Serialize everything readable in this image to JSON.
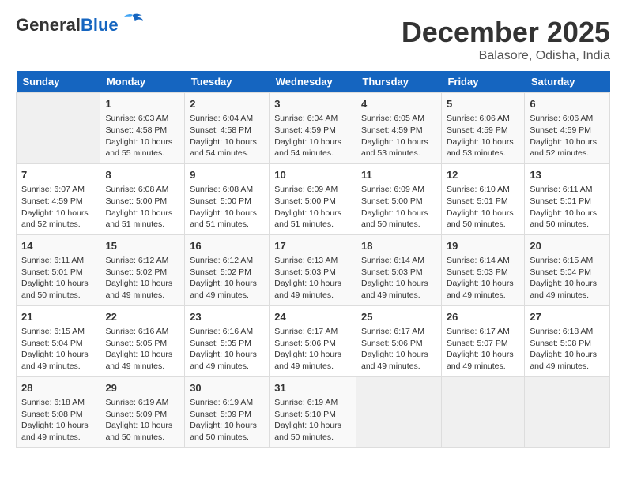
{
  "logo": {
    "line1": "General",
    "line2": "Blue"
  },
  "title": "December 2025",
  "location": "Balasore, Odisha, India",
  "weekdays": [
    "Sunday",
    "Monday",
    "Tuesday",
    "Wednesday",
    "Thursday",
    "Friday",
    "Saturday"
  ],
  "weeks": [
    [
      {
        "day": "",
        "info": ""
      },
      {
        "day": "1",
        "info": "Sunrise: 6:03 AM\nSunset: 4:58 PM\nDaylight: 10 hours\nand 55 minutes."
      },
      {
        "day": "2",
        "info": "Sunrise: 6:04 AM\nSunset: 4:58 PM\nDaylight: 10 hours\nand 54 minutes."
      },
      {
        "day": "3",
        "info": "Sunrise: 6:04 AM\nSunset: 4:59 PM\nDaylight: 10 hours\nand 54 minutes."
      },
      {
        "day": "4",
        "info": "Sunrise: 6:05 AM\nSunset: 4:59 PM\nDaylight: 10 hours\nand 53 minutes."
      },
      {
        "day": "5",
        "info": "Sunrise: 6:06 AM\nSunset: 4:59 PM\nDaylight: 10 hours\nand 53 minutes."
      },
      {
        "day": "6",
        "info": "Sunrise: 6:06 AM\nSunset: 4:59 PM\nDaylight: 10 hours\nand 52 minutes."
      }
    ],
    [
      {
        "day": "7",
        "info": "Sunrise: 6:07 AM\nSunset: 4:59 PM\nDaylight: 10 hours\nand 52 minutes."
      },
      {
        "day": "8",
        "info": "Sunrise: 6:08 AM\nSunset: 5:00 PM\nDaylight: 10 hours\nand 51 minutes."
      },
      {
        "day": "9",
        "info": "Sunrise: 6:08 AM\nSunset: 5:00 PM\nDaylight: 10 hours\nand 51 minutes."
      },
      {
        "day": "10",
        "info": "Sunrise: 6:09 AM\nSunset: 5:00 PM\nDaylight: 10 hours\nand 51 minutes."
      },
      {
        "day": "11",
        "info": "Sunrise: 6:09 AM\nSunset: 5:00 PM\nDaylight: 10 hours\nand 50 minutes."
      },
      {
        "day": "12",
        "info": "Sunrise: 6:10 AM\nSunset: 5:01 PM\nDaylight: 10 hours\nand 50 minutes."
      },
      {
        "day": "13",
        "info": "Sunrise: 6:11 AM\nSunset: 5:01 PM\nDaylight: 10 hours\nand 50 minutes."
      }
    ],
    [
      {
        "day": "14",
        "info": "Sunrise: 6:11 AM\nSunset: 5:01 PM\nDaylight: 10 hours\nand 50 minutes."
      },
      {
        "day": "15",
        "info": "Sunrise: 6:12 AM\nSunset: 5:02 PM\nDaylight: 10 hours\nand 49 minutes."
      },
      {
        "day": "16",
        "info": "Sunrise: 6:12 AM\nSunset: 5:02 PM\nDaylight: 10 hours\nand 49 minutes."
      },
      {
        "day": "17",
        "info": "Sunrise: 6:13 AM\nSunset: 5:03 PM\nDaylight: 10 hours\nand 49 minutes."
      },
      {
        "day": "18",
        "info": "Sunrise: 6:14 AM\nSunset: 5:03 PM\nDaylight: 10 hours\nand 49 minutes."
      },
      {
        "day": "19",
        "info": "Sunrise: 6:14 AM\nSunset: 5:03 PM\nDaylight: 10 hours\nand 49 minutes."
      },
      {
        "day": "20",
        "info": "Sunrise: 6:15 AM\nSunset: 5:04 PM\nDaylight: 10 hours\nand 49 minutes."
      }
    ],
    [
      {
        "day": "21",
        "info": "Sunrise: 6:15 AM\nSunset: 5:04 PM\nDaylight: 10 hours\nand 49 minutes."
      },
      {
        "day": "22",
        "info": "Sunrise: 6:16 AM\nSunset: 5:05 PM\nDaylight: 10 hours\nand 49 minutes."
      },
      {
        "day": "23",
        "info": "Sunrise: 6:16 AM\nSunset: 5:05 PM\nDaylight: 10 hours\nand 49 minutes."
      },
      {
        "day": "24",
        "info": "Sunrise: 6:17 AM\nSunset: 5:06 PM\nDaylight: 10 hours\nand 49 minutes."
      },
      {
        "day": "25",
        "info": "Sunrise: 6:17 AM\nSunset: 5:06 PM\nDaylight: 10 hours\nand 49 minutes."
      },
      {
        "day": "26",
        "info": "Sunrise: 6:17 AM\nSunset: 5:07 PM\nDaylight: 10 hours\nand 49 minutes."
      },
      {
        "day": "27",
        "info": "Sunrise: 6:18 AM\nSunset: 5:08 PM\nDaylight: 10 hours\nand 49 minutes."
      }
    ],
    [
      {
        "day": "28",
        "info": "Sunrise: 6:18 AM\nSunset: 5:08 PM\nDaylight: 10 hours\nand 49 minutes."
      },
      {
        "day": "29",
        "info": "Sunrise: 6:19 AM\nSunset: 5:09 PM\nDaylight: 10 hours\nand 50 minutes."
      },
      {
        "day": "30",
        "info": "Sunrise: 6:19 AM\nSunset: 5:09 PM\nDaylight: 10 hours\nand 50 minutes."
      },
      {
        "day": "31",
        "info": "Sunrise: 6:19 AM\nSunset: 5:10 PM\nDaylight: 10 hours\nand 50 minutes."
      },
      {
        "day": "",
        "info": ""
      },
      {
        "day": "",
        "info": ""
      },
      {
        "day": "",
        "info": ""
      }
    ]
  ]
}
